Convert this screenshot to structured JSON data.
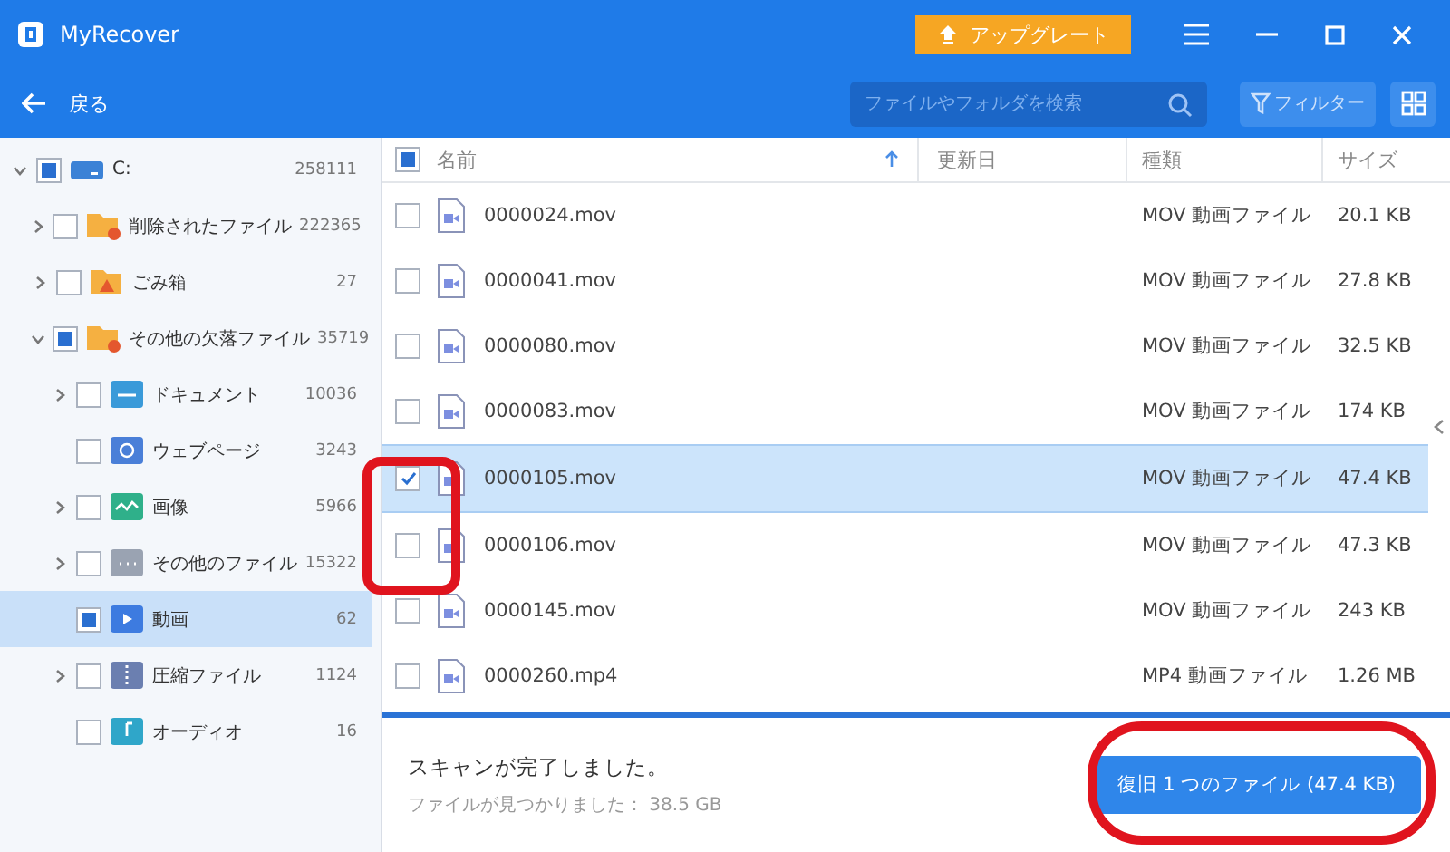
{
  "window": {
    "title": "MyRecover",
    "upgrade_button": "アップグレート"
  },
  "toolbar": {
    "back": "戻る",
    "search": {
      "placeholder": "ファイルやフォルダを検索"
    },
    "filter": "フィルター"
  },
  "sidebar": {
    "tree": [
      {
        "label": "C:",
        "count": "258111",
        "kind": "drive",
        "expandable": true,
        "expanded": true,
        "partial": true,
        "selected": false,
        "children": [
          {
            "label": "削除されたファイル",
            "count": "222365",
            "kind": "folder-trash",
            "expandable": true,
            "expanded": false,
            "partial": false,
            "selected": false
          },
          {
            "label": "ごみ箱",
            "count": "27",
            "kind": "recycle",
            "expandable": true,
            "expanded": false,
            "partial": false,
            "selected": false
          },
          {
            "label": "その他の欠落ファイル",
            "count": "35719",
            "kind": "folder-missing",
            "expandable": true,
            "expanded": true,
            "partial": true,
            "selected": false,
            "children": [
              {
                "label": "ドキュメント",
                "count": "10036",
                "kind": "document",
                "expandable": true,
                "expanded": false,
                "partial": false,
                "selected": false
              },
              {
                "label": "ウェブページ",
                "count": "3243",
                "kind": "web",
                "expandable": false,
                "partial": false,
                "selected": false
              },
              {
                "label": "画像",
                "count": "5966",
                "kind": "image",
                "expandable": true,
                "expanded": false,
                "partial": false,
                "selected": false
              },
              {
                "label": "その他のファイル",
                "count": "15322",
                "kind": "other",
                "expandable": true,
                "expanded": false,
                "partial": false,
                "selected": false
              },
              {
                "label": "動画",
                "count": "62",
                "kind": "video",
                "expandable": false,
                "partial": true,
                "selected": true
              },
              {
                "label": "圧縮ファイル",
                "count": "1124",
                "kind": "archive",
                "expandable": true,
                "expanded": false,
                "partial": false,
                "selected": false
              },
              {
                "label": "オーディオ",
                "count": "16",
                "kind": "audio",
                "expandable": false,
                "partial": false,
                "selected": false
              }
            ]
          }
        ]
      }
    ]
  },
  "table": {
    "select_all_partial": true,
    "columns": [
      {
        "label": "名前",
        "sorted": true
      },
      {
        "label": "更新日",
        "sorted": false
      },
      {
        "label": "種類",
        "sorted": false
      },
      {
        "label": "サイズ",
        "sorted": false
      }
    ],
    "rows": [
      {
        "name": "0000024.mov",
        "type": "MOV 動画ファイル",
        "size": "20.1 KB",
        "checked": false,
        "selected": false
      },
      {
        "name": "0000041.mov",
        "type": "MOV 動画ファイル",
        "size": "27.8 KB",
        "checked": false,
        "selected": false
      },
      {
        "name": "0000080.mov",
        "type": "MOV 動画ファイル",
        "size": "32.5 KB",
        "checked": false,
        "selected": false
      },
      {
        "name": "0000083.mov",
        "type": "MOV 動画ファイル",
        "size": "174 KB",
        "checked": false,
        "selected": false
      },
      {
        "name": "0000105.mov",
        "type": "MOV 動画ファイル",
        "size": "47.4 KB",
        "checked": true,
        "selected": true
      },
      {
        "name": "0000106.mov",
        "type": "MOV 動画ファイル",
        "size": "47.3 KB",
        "checked": false,
        "selected": false
      },
      {
        "name": "0000145.mov",
        "type": "MOV 動画ファイル",
        "size": "243 KB",
        "checked": false,
        "selected": false
      },
      {
        "name": "0000260.mp4",
        "type": "MP4 動画ファイル",
        "size": "1.26 MB",
        "checked": false,
        "selected": false
      }
    ]
  },
  "footer": {
    "status": "スキャンが完了しました。",
    "found": "ファイルが見つかりました： 38.5 GB",
    "recover_button": "復旧 1 つのファイル (47.4 KB)"
  }
}
